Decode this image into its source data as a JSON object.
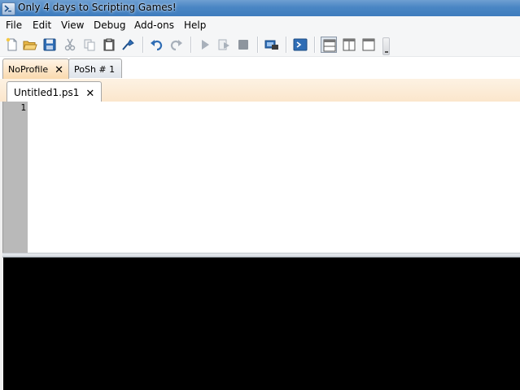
{
  "window": {
    "title": "Only 4 days to Scripting Games!"
  },
  "menu": [
    "File",
    "Edit",
    "View",
    "Debug",
    "Add-ons",
    "Help"
  ],
  "toolbar": {
    "buttons": [
      "new-file-icon",
      "open-folder-icon",
      "save-icon",
      "cut-icon",
      "copy-icon",
      "paste-icon",
      "clear-icon",
      "undo-icon",
      "redo-icon",
      "run-script-icon",
      "run-selection-icon",
      "stop-icon",
      "remote-powershell-icon",
      "powershell-console-icon"
    ],
    "layouts": [
      "script-pane-top-icon",
      "script-pane-right-icon",
      "script-pane-maximized-icon"
    ]
  },
  "runspace_tabs": [
    {
      "label": "NoProfile",
      "active": true,
      "closable": true
    },
    {
      "label": "PoSh # 1",
      "active": false,
      "closable": false
    }
  ],
  "script_tabs": [
    {
      "label": "Untitled1.ps1",
      "active": true,
      "closable": true
    }
  ],
  "editor": {
    "line_numbers": [
      "1"
    ]
  },
  "colors": {
    "titlebar": "#4a86c4",
    "active_tab": "#f9d8ab",
    "gutter": "#b9b9b9",
    "output_bg": "#000000"
  }
}
